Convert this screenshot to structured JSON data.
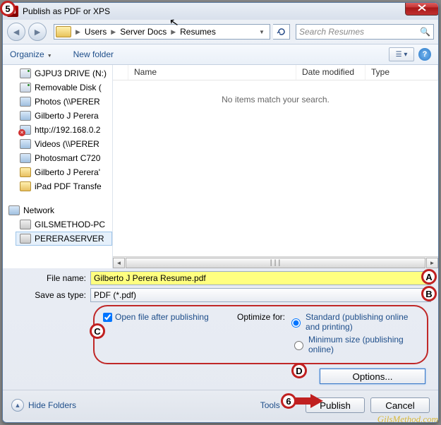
{
  "window": {
    "title": "Publish as PDF or XPS"
  },
  "nav": {
    "breadcrumb": [
      "Users",
      "Server Docs",
      "Resumes"
    ],
    "search_placeholder": "Search Resumes"
  },
  "toolbar": {
    "organize": "Organize",
    "new_folder": "New folder"
  },
  "columns": {
    "name": "Name",
    "date": "Date modified",
    "type": "Type"
  },
  "empty_message": "No items match your search.",
  "sidebar": {
    "items": [
      {
        "label": "GJPU3 DRIVE (N:)",
        "kind": "drive"
      },
      {
        "label": "Removable Disk (",
        "kind": "drive"
      },
      {
        "label": "Photos (\\\\PERER",
        "kind": "network"
      },
      {
        "label": "Gilberto J Perera",
        "kind": "network"
      },
      {
        "label": "http://192.168.0.2",
        "kind": "err"
      },
      {
        "label": "Videos (\\\\PERER",
        "kind": "network"
      },
      {
        "label": "Photosmart C720",
        "kind": "network"
      },
      {
        "label": "Gilberto J Perera'",
        "kind": "folder"
      },
      {
        "label": "iPad PDF Transfe",
        "kind": "folder"
      }
    ],
    "network_label": "Network",
    "hosts": [
      {
        "label": "GILSMETHOD-PC"
      },
      {
        "label": "PERERASERVER"
      }
    ]
  },
  "form": {
    "file_name_label": "File name:",
    "file_name_value": "Gilberto J Perera Resume.pdf",
    "save_type_label": "Save as type:",
    "save_type_value": "PDF (*.pdf)"
  },
  "options": {
    "open_after": "Open file after publishing",
    "optimize_for": "Optimize for:",
    "standard": "Standard (publishing online and printing)",
    "minimum": "Minimum size (publishing online)",
    "options_btn": "Options..."
  },
  "footer": {
    "hide_folders": "Hide Folders",
    "tools": "Tools",
    "publish": "Publish",
    "cancel": "Cancel"
  },
  "annotations": {
    "b5": "5",
    "bA": "A",
    "bB": "B",
    "bC": "C",
    "bD": "D",
    "b6": "6"
  },
  "watermark": "GilsMethod.com"
}
